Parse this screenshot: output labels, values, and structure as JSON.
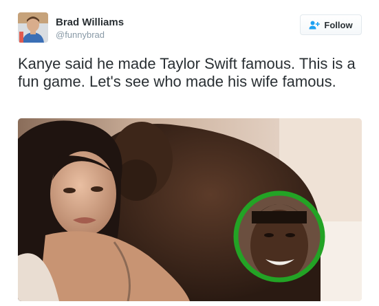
{
  "author": {
    "name": "Brad Williams",
    "handle": "@funnybrad"
  },
  "follow_button": {
    "label": "Follow",
    "icon": "add-user-icon",
    "color": "#1da1f2"
  },
  "tweet": {
    "text": "Kanye said he made Taylor Swift famous. This is a fun game. Let's see who made his wife famous."
  },
  "media": {
    "highlight_ring_color": "#23a325"
  }
}
